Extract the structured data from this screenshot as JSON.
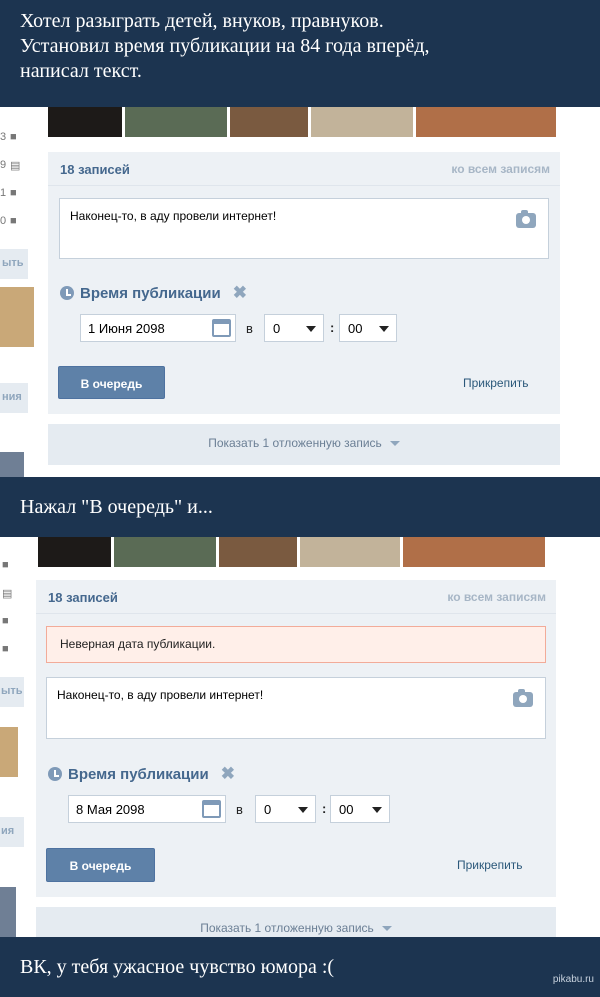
{
  "banners": {
    "top": [
      "Хотел разыграть детей, внуков, правнуков.",
      "Установил время публикации на 84 года вперёд,",
      "написал текст."
    ],
    "middle": "Нажал \"В очередь\" и...",
    "bottom": "ВК, у тебя ужасное чувство юмора :(",
    "watermark": "pikabu.ru"
  },
  "sidebar_fragments": {
    "counts": [
      "3",
      "9",
      "1",
      "0"
    ],
    "cut_labels_1": [
      "ыть",
      "ния"
    ],
    "cut_labels_2": [
      "ыть",
      "ия"
    ]
  },
  "before": {
    "header": {
      "count": "18 записей",
      "all_link": "ко всем записям"
    },
    "post_text": "Наконец-то, в аду провели интернет!",
    "time_label": "Время публикации",
    "date_value": "1 Июня 2098",
    "at": "в",
    "hour": "0",
    "minute": "00",
    "queue_button": "В очередь",
    "attach_link": "Прикрепить",
    "postponed_link": "Показать 1 отложенную запись"
  },
  "after": {
    "header": {
      "count": "18 записей",
      "all_link": "ко всем записям"
    },
    "error": "Неверная дата публикации.",
    "post_text": "Наконец-то, в аду провели интернет!",
    "time_label": "Время публикации",
    "date_value": "8 Мая 2098",
    "at": "в",
    "hour": "0",
    "minute": "00",
    "queue_button": "В очередь",
    "attach_link": "Прикрепить",
    "postponed_link": "Показать 1 отложенную запись"
  },
  "colors": {
    "banner": "#1c3450",
    "wall": "#edf1f5",
    "accent": "#45688e",
    "button": "#5e81a8",
    "error_bg": "#ffefe9"
  }
}
